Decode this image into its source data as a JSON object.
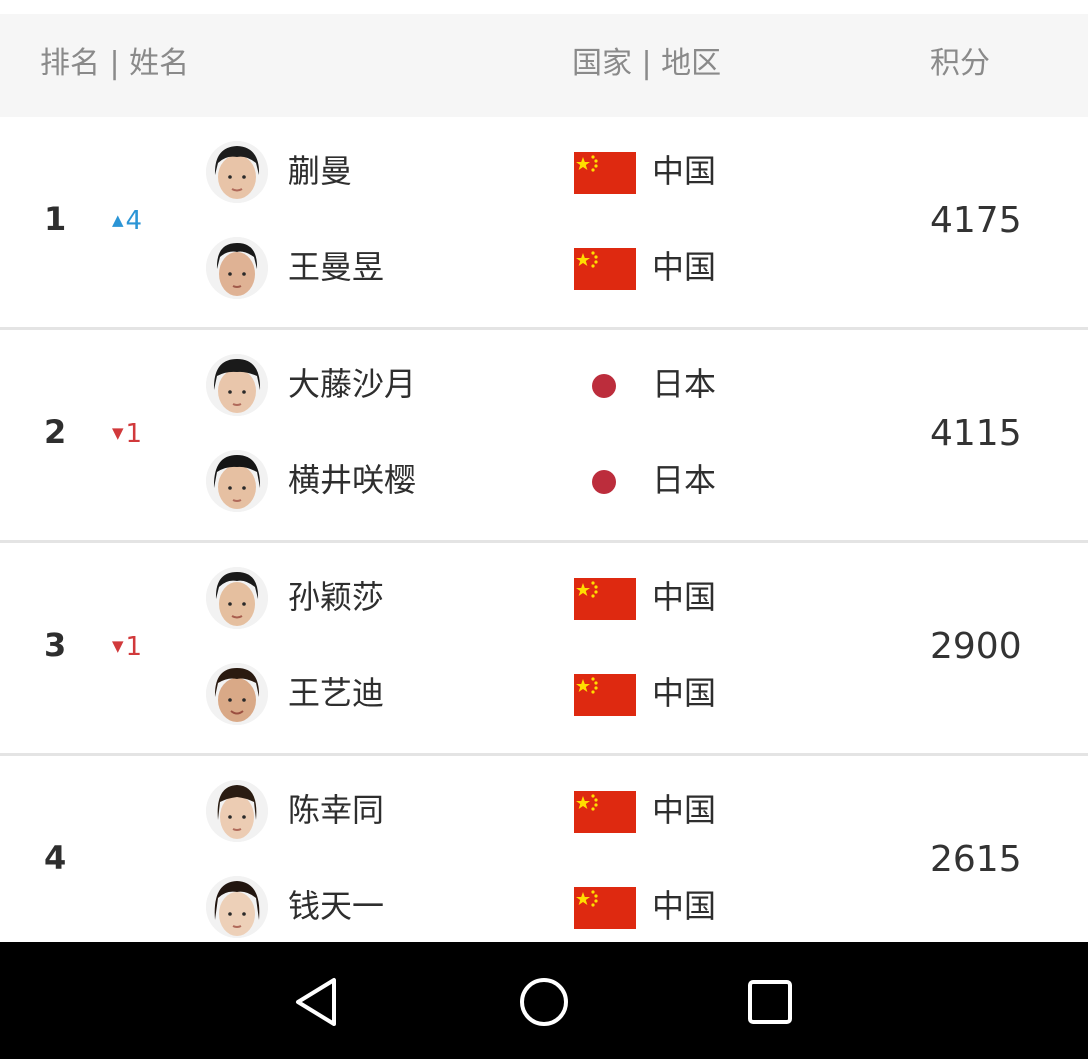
{
  "header": {
    "rank_name": "排名 | 姓名",
    "country_region": "国家 | 地区",
    "points": "积分"
  },
  "teams": [
    {
      "rank": "1",
      "change": {
        "direction": "up",
        "value": "4"
      },
      "points": "4175",
      "players": [
        {
          "name": "蒯曼",
          "country": "中国",
          "flag": "china-flag"
        },
        {
          "name": "王曼昱",
          "country": "中国",
          "flag": "china-flag"
        }
      ]
    },
    {
      "rank": "2",
      "change": {
        "direction": "down",
        "value": "1"
      },
      "points": "4115",
      "players": [
        {
          "name": "大藤沙月",
          "country": "日本",
          "flag": "japan-flag"
        },
        {
          "name": "横井咲樱",
          "country": "日本",
          "flag": "japan-flag"
        }
      ]
    },
    {
      "rank": "3",
      "change": {
        "direction": "down",
        "value": "1"
      },
      "points": "2900",
      "players": [
        {
          "name": "孙颖莎",
          "country": "中国",
          "flag": "china-flag"
        },
        {
          "name": "王艺迪",
          "country": "中国",
          "flag": "china-flag"
        }
      ]
    },
    {
      "rank": "4",
      "change": null,
      "points": "2615",
      "players": [
        {
          "name": "陈幸同",
          "country": "中国",
          "flag": "china-flag"
        },
        {
          "name": "钱天一",
          "country": "中国",
          "flag": "china-flag"
        }
      ]
    }
  ],
  "colors": {
    "rank_up": "#2b95d6",
    "rank_down": "#d1393b",
    "china_red": "#de2910",
    "china_star": "#ffde00",
    "japan_red": "#bc2d3c",
    "header_bg": "#f6f6f6"
  },
  "nav": {
    "back_icon": "back-triangle-icon",
    "home_icon": "home-circle-icon",
    "recent_icon": "recent-apps-square-icon"
  }
}
